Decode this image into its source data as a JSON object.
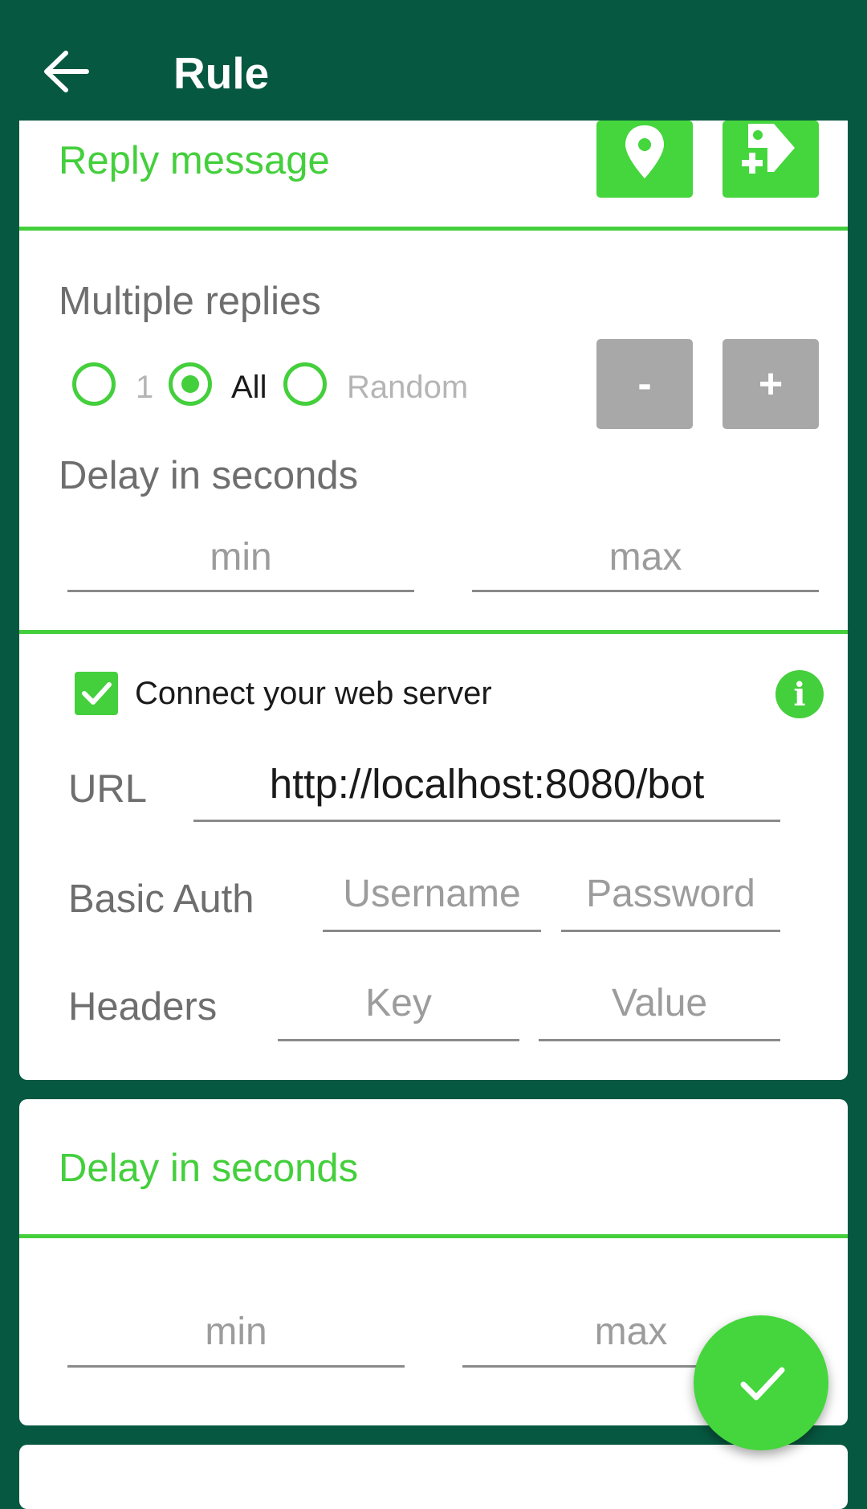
{
  "header": {
    "title": "Rule"
  },
  "reply": {
    "title": "Reply message"
  },
  "multiple": {
    "title": "Multiple replies",
    "options": [
      "1",
      "All",
      "Random"
    ],
    "selected": "All",
    "minus_label": "-",
    "plus_label": "+"
  },
  "delay1": {
    "title": "Delay in seconds",
    "min_placeholder": "min",
    "max_placeholder": "max"
  },
  "webserver": {
    "checkbox_label": "Connect your web server",
    "checked": true,
    "info_label": "i",
    "url_label": "URL",
    "url_value": "http://localhost:8080/bot",
    "auth_label": "Basic Auth",
    "username_placeholder": "Username",
    "password_placeholder": "Password",
    "headers_label": "Headers",
    "key_placeholder": "Key",
    "value_placeholder": "Value"
  },
  "delay2": {
    "title": "Delay in seconds",
    "min_placeholder": "min",
    "max_placeholder": "max"
  },
  "icons": {
    "back": "arrow-left-icon",
    "location": "location-pin-icon",
    "add_tag": "add-tag-icon",
    "info": "info-icon",
    "check": "check-icon"
  },
  "colors": {
    "primary_dark": "#075840",
    "accent_green": "#44cf3c",
    "gray_button": "#a8a8a8"
  }
}
